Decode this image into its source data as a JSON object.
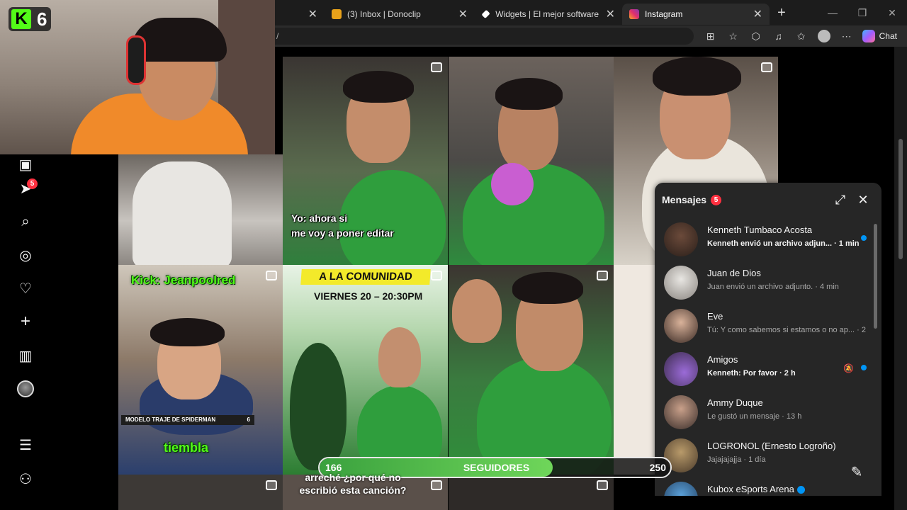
{
  "browser": {
    "tabs": [
      {
        "label": "",
        "active": false
      },
      {
        "label": "(3) Inbox | Donoclip",
        "active": false
      },
      {
        "label": "Widgets | El mejor software para p",
        "active": false
      },
      {
        "label": "Instagram",
        "active": true
      }
    ],
    "url": "/",
    "chat_label": "Chat"
  },
  "stream": {
    "kick_logo": "K",
    "viewer_count": "6"
  },
  "nav": {
    "notifications_badge": "5",
    "icons": [
      "reels-icon",
      "messages-icon",
      "search-icon",
      "explore-icon",
      "heart-icon",
      "create-icon",
      "dashboard-icon",
      "profile-avatar",
      "menu-icon",
      "more-icon"
    ]
  },
  "reels": {
    "caption_1_line1": "Yo: ahora si",
    "caption_1_line2": "me voy a poner editar",
    "kick_handle": "Kick: Jeanpoolred",
    "tiembla": "tiembla",
    "poster_banner": "A LA COMUNIDAD",
    "poster_date": "VIERNES 20 – 20:30PM",
    "spider_label": "MODELO TRAJE DE SPIDERMAN",
    "spider_label_num": "6",
    "bottom_caption": "arreché ¿por qué no escribió esta canción?"
  },
  "messages": {
    "title": "Mensajes",
    "badge": "5",
    "conversations": [
      {
        "name": "Kenneth Tumbaco Acosta",
        "preview": "Kenneth envió un archivo adjun... · 1 min",
        "unread": true,
        "muted": false
      },
      {
        "name": "Juan de Dios",
        "preview": "Juan envió un archivo adjunto. · 4 min",
        "unread": false,
        "muted": false
      },
      {
        "name": "Eve",
        "preview": "Tú: Y como sabemos si estamos o no ap... · 2 h",
        "unread": false,
        "muted": false
      },
      {
        "name": "Amigos",
        "preview": "Kenneth: Por favor · 2 h",
        "unread": true,
        "muted": true
      },
      {
        "name": "Ammy Duque",
        "preview": "Le gustó un mensaje · 13 h",
        "unread": false,
        "muted": false
      },
      {
        "name": "LOGRONOL (Ernesto Logroño)",
        "preview": "Jajajajajja · 1 día",
        "unread": false,
        "muted": false
      },
      {
        "name": "Kubox eSports Arena",
        "preview": "",
        "unread": false,
        "muted": false,
        "verified": true
      }
    ]
  },
  "goal": {
    "current": "166",
    "label": "SEGUIDORES",
    "target": "250",
    "progress": 0.664
  },
  "colors": {
    "kick_green": "#53fc18",
    "ig_blue": "#0095f6",
    "badge_red": "#ff3040"
  }
}
